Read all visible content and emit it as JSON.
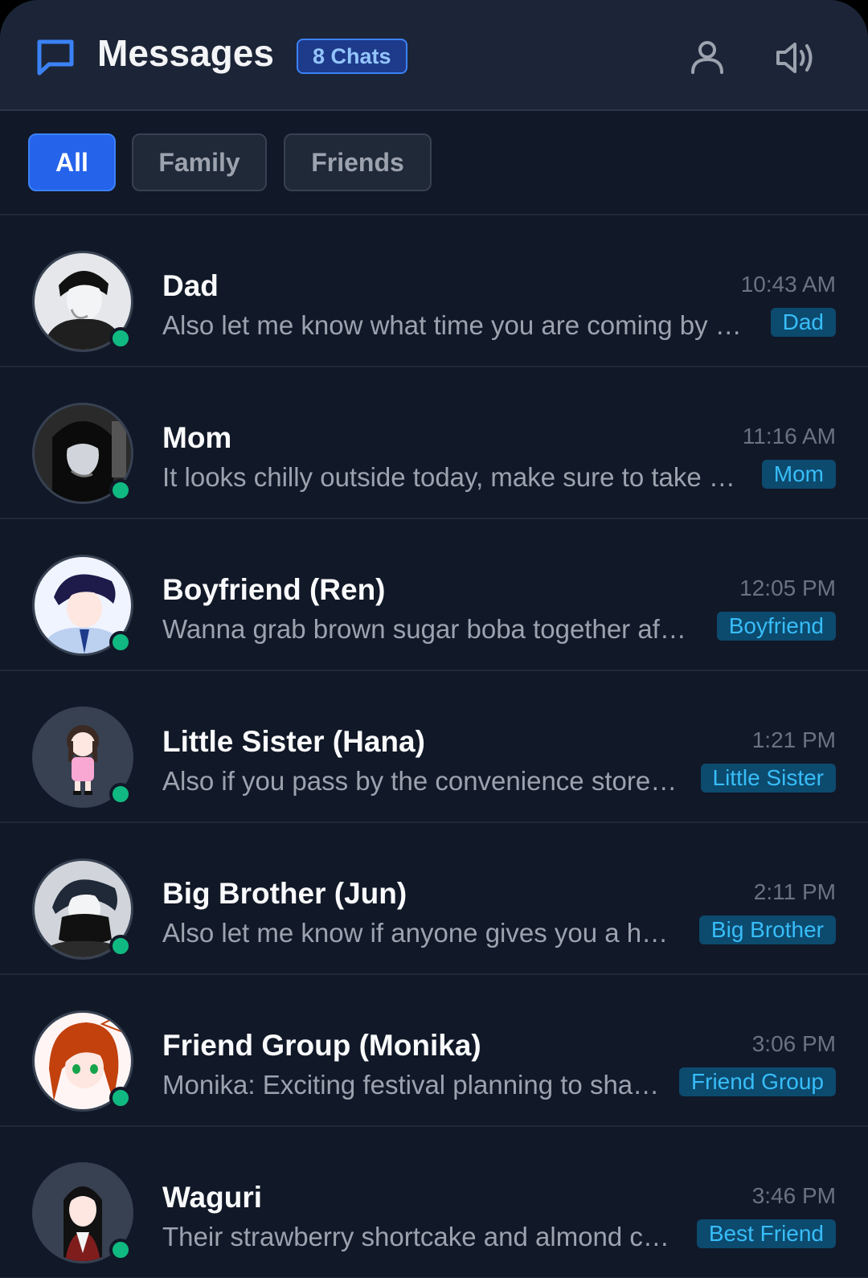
{
  "header": {
    "title": "Messages",
    "chat_count": "8 Chats",
    "icons": {
      "app": "chat-bubble-icon",
      "profile": "user-icon",
      "sound": "volume-icon"
    }
  },
  "filters": [
    {
      "label": "All",
      "active": true
    },
    {
      "label": "Family",
      "active": false
    },
    {
      "label": "Friends",
      "active": false
    }
  ],
  "colors": {
    "accent": "#2563eb",
    "online": "#10b981",
    "tag_text": "#38bdf8",
    "tag_bg": "#0c4a6e"
  },
  "chats": [
    {
      "name": "Dad",
      "time": "10:43 AM",
      "preview": "Also let me know what time you are coming by f…",
      "tag": "Dad",
      "online": true
    },
    {
      "name": "Mom",
      "time": "11:16 AM",
      "preview": "It looks chilly outside today, make sure to take y…",
      "tag": "Mom",
      "online": true
    },
    {
      "name": "Boyfriend (Ren)",
      "time": "12:05 PM",
      "preview": "Wanna grab brown sugar boba together aft…",
      "tag": "Boyfriend",
      "online": true
    },
    {
      "name": "Little Sister (Hana)",
      "time": "1:21 PM",
      "preview": "Also if you pass by the convenience store, …",
      "tag": "Little Sister",
      "online": true
    },
    {
      "name": "Big Brother (Jun)",
      "time": "2:11 PM",
      "preview": "Also let me know if anyone gives you a ha…",
      "tag": "Big Brother",
      "online": true
    },
    {
      "name": "Friend Group (Monika)",
      "time": "3:06 PM",
      "preview": "Monika: Exciting festival planning to shar…",
      "tag": "Friend Group",
      "online": true
    },
    {
      "name": "Waguri",
      "time": "3:46 PM",
      "preview": "Their strawberry shortcake and almond cr…",
      "tag": "Best Friend",
      "online": true
    }
  ]
}
